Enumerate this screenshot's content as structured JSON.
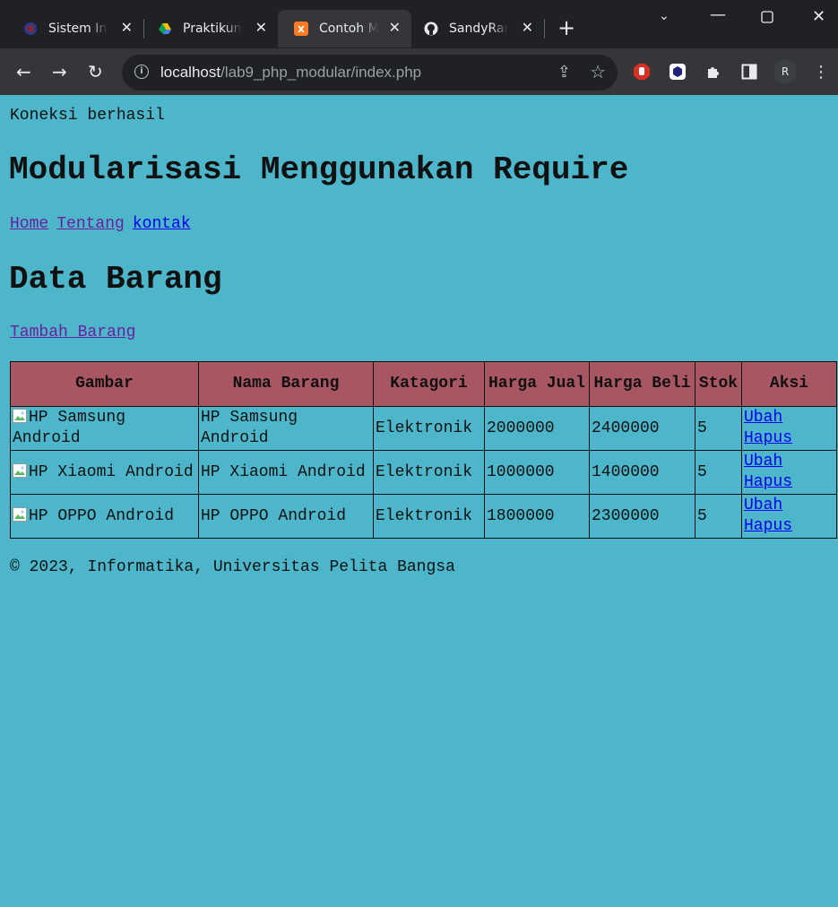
{
  "browser": {
    "tabs": [
      {
        "title": "Sistem Informasi",
        "favicon": "university-icon",
        "active": false
      },
      {
        "title": "Praktikum",
        "favicon": "google-drive-icon",
        "active": false
      },
      {
        "title": "Contoh Modularisasi",
        "favicon": "xampp-icon",
        "active": true
      },
      {
        "title": "SandyRamadhan",
        "favicon": "github-icon",
        "active": false
      }
    ],
    "url_host": "localhost",
    "url_path": "/lab9_php_modular/index.php",
    "profile_initial": "R"
  },
  "page": {
    "status": "Koneksi berhasil",
    "heading": "Modularisasi Menggunakan Require",
    "menu": {
      "home": "Home",
      "tentang": "Tentang",
      "kontak": "kontak"
    },
    "section_title": "Data Barang",
    "add_link": "Tambah Barang",
    "table": {
      "headers": [
        "Gambar",
        "Nama Barang",
        "Katagori",
        "Harga Jual",
        "Harga Beli",
        "Stok",
        "Aksi"
      ],
      "rows": [
        {
          "gambar_alt": "HP Samsung Android",
          "nama": "HP Samsung Android",
          "kategori": "Elektronik",
          "harga_jual": "2000000",
          "harga_beli": "2400000",
          "stok": "5",
          "ubah": "Ubah",
          "hapus": "Hapus"
        },
        {
          "gambar_alt": "HP Xiaomi Android",
          "nama": "HP Xiaomi Android",
          "kategori": "Elektronik",
          "harga_jual": "1000000",
          "harga_beli": "1400000",
          "stok": "5",
          "ubah": "Ubah",
          "hapus": "Hapus"
        },
        {
          "gambar_alt": "HP OPPO Android",
          "nama": "HP OPPO Android",
          "kategori": "Elektronik",
          "harga_jual": "1800000",
          "harga_beli": "2300000",
          "stok": "5",
          "ubah": "Ubah",
          "hapus": "Hapus"
        }
      ]
    },
    "footer": "© 2023, Informatika, Universitas Pelita Bangsa"
  },
  "colors": {
    "page_bg": "#4db6ca",
    "header_bg": "#a85662"
  }
}
